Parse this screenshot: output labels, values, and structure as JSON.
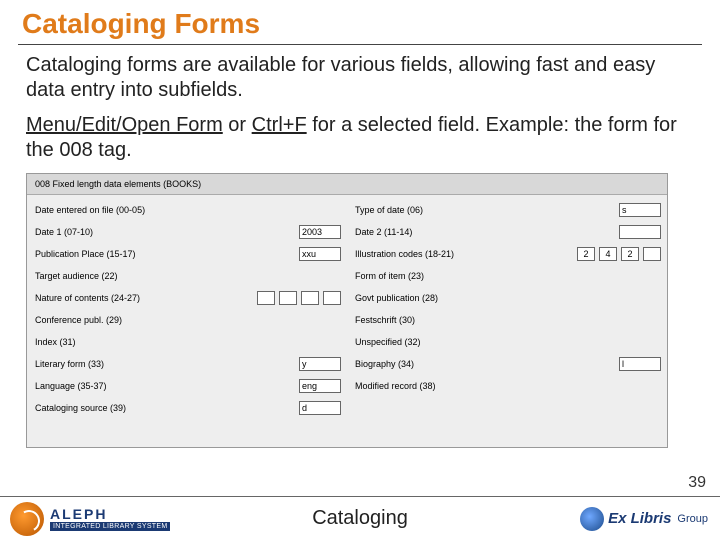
{
  "title": "Cataloging Forms",
  "intro": "Cataloging forms are available for various fields, allowing fast and easy data entry into subfields.",
  "nav": {
    "menu_path": "Menu/Edit/Open Form",
    "or": " or ",
    "shortcut": "Ctrl+F",
    "rest": " for a selected field. Example: the form for the 008 tag."
  },
  "form": {
    "header": "008 Fixed length data elements (BOOKS)",
    "left": [
      {
        "label": "Date entered on file (00-05)",
        "vals": []
      },
      {
        "label": "Date 1 (07-10)",
        "vals": [
          "2003"
        ]
      },
      {
        "label": "Publication Place (15-17)",
        "vals": [
          "xxu"
        ]
      },
      {
        "label": "Target audience (22)",
        "vals": []
      },
      {
        "label": "Nature of contents (24-27)",
        "vals": [
          "",
          "",
          "",
          ""
        ]
      },
      {
        "label": "Conference publ. (29)",
        "vals": []
      },
      {
        "label": "Index (31)",
        "vals": []
      },
      {
        "label": "Literary form (33)",
        "vals": [
          "y"
        ]
      },
      {
        "label": "Language (35-37)",
        "vals": [
          "eng"
        ]
      },
      {
        "label": "Cataloging source (39)",
        "vals": [
          "d"
        ]
      }
    ],
    "right": [
      {
        "label": "Type of date (06)",
        "vals": [
          "s"
        ]
      },
      {
        "label": "Date 2 (11-14)",
        "vals": [
          ""
        ]
      },
      {
        "label": "Illustration codes (18-21)",
        "vals": [
          "2",
          "4",
          "2",
          ""
        ]
      },
      {
        "label": "Form of item (23)",
        "vals": []
      },
      {
        "label": "Govt publication (28)",
        "vals": []
      },
      {
        "label": "Festschrift (30)",
        "vals": []
      },
      {
        "label": "Unspecified (32)",
        "vals": []
      },
      {
        "label": "Biography (34)",
        "vals": [
          "l"
        ]
      },
      {
        "label": "Modified record (38)",
        "vals": []
      }
    ]
  },
  "page_number": "39",
  "footer": {
    "aleph_name": "ALEPH",
    "aleph_sub": "INTEGRATED LIBRARY SYSTEM",
    "center": "Cataloging",
    "exlibris_brand": "Ex Libris",
    "exlibris_sub": "Group"
  }
}
